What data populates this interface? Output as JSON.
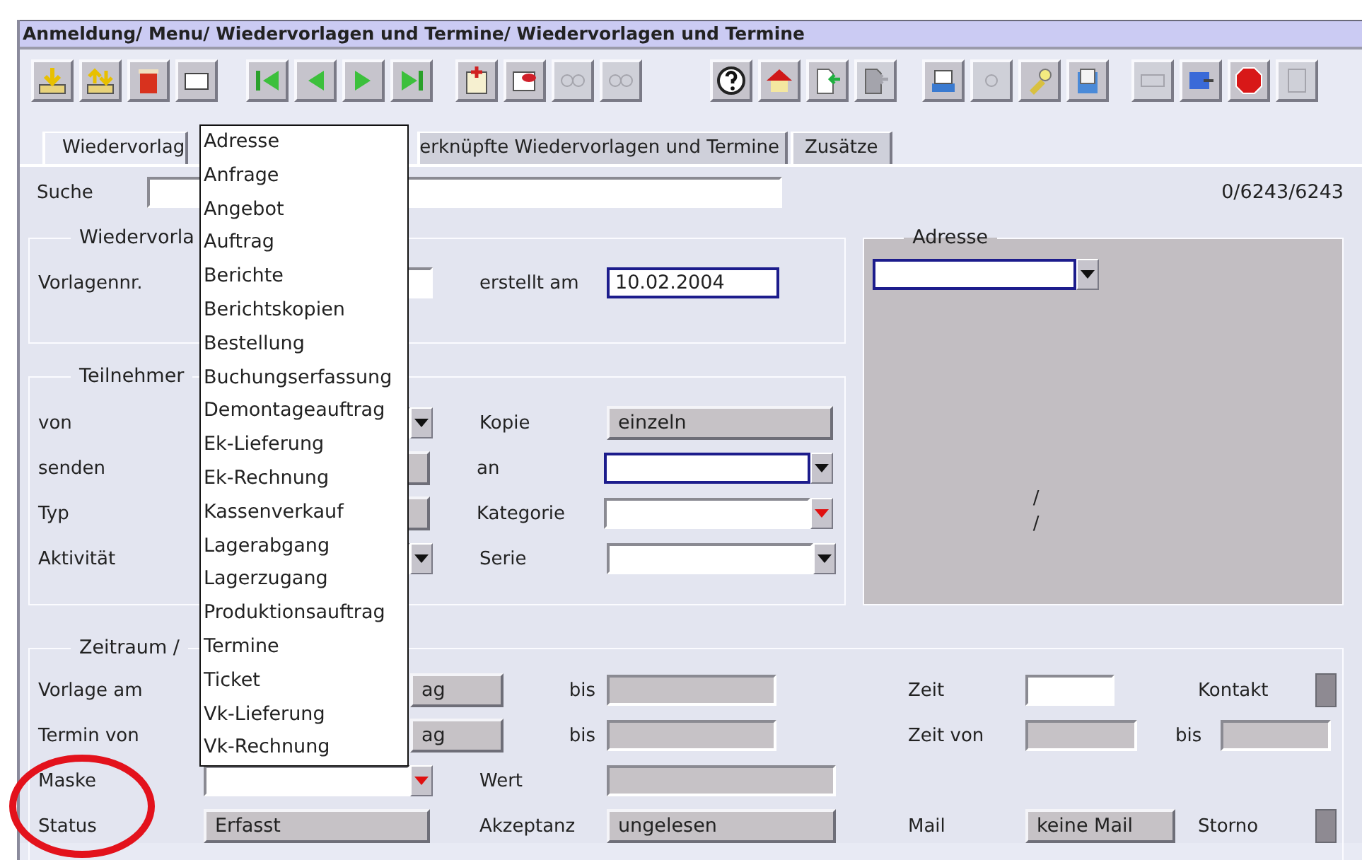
{
  "title_bar": {
    "title": "Anmeldung/ Menu/ Wiedervorlagen und Termine/ Wiedervorlagen und Termine"
  },
  "toolbar": {
    "buttons": [
      {
        "disabled": false
      },
      {
        "disabled": false
      },
      {
        "disabled": false
      },
      {
        "disabled": false
      },
      {
        "disabled": false
      },
      {
        "disabled": false
      },
      {
        "disabled": false
      },
      {
        "disabled": false
      },
      {
        "disabled": false
      },
      {
        "disabled": false
      },
      {
        "disabled": true
      },
      {
        "disabled": true
      },
      {
        "disabled": false
      },
      {
        "disabled": false
      },
      {
        "disabled": false
      },
      {
        "disabled": true
      },
      {
        "disabled": false
      },
      {
        "disabled": true
      },
      {
        "disabled": false
      },
      {
        "disabled": false
      },
      {
        "disabled": true
      },
      {
        "disabled": false
      },
      {
        "disabled": false
      },
      {
        "disabled": true
      }
    ]
  },
  "tabs": [
    {
      "label": "Wiedervorlag",
      "selected": true
    },
    {
      "label": "erknüpfte Wiedervorlagen und Termine",
      "selected": false
    },
    {
      "label": "Zusätze",
      "selected": false
    }
  ],
  "search": {
    "label": "Suche",
    "counter": "0/6243/6243"
  },
  "template_group": {
    "legend": "Wiedervorla",
    "number_label": "Vorlagennr.",
    "created_label": "erstellt am",
    "created_value": "10.02.2004",
    "created_focused": true
  },
  "address_panel": {
    "legend": "Adresse",
    "combo": {
      "focused": true
    },
    "lines": [
      "/",
      "/"
    ]
  },
  "participants_group": {
    "legend": "Teilnehmer",
    "rows": [
      {
        "label": "von",
        "control": {
          "kind": "combo",
          "focused": false,
          "mandatory": false
        },
        "right_label": "Kopie",
        "right": {
          "kind": "button",
          "text": "einzeln"
        }
      },
      {
        "label": "senden",
        "control": {
          "kind": "button"
        },
        "right_label": "an",
        "right": {
          "kind": "combo",
          "focused": true,
          "mandatory": false
        }
      },
      {
        "label": "Typ",
        "control": {
          "kind": "button"
        },
        "right_label": "Kategorie",
        "right": {
          "kind": "combo",
          "focused": false,
          "mandatory": true
        }
      },
      {
        "label": "Aktivität",
        "control": {
          "kind": "combo",
          "focused": false,
          "mandatory": false
        },
        "right_label": "Serie",
        "right": {
          "kind": "combo",
          "focused": false,
          "mandatory": false
        }
      }
    ]
  },
  "period_group": {
    "legend": "Zeitraum /",
    "rows": [
      {
        "label": "Vorlage am",
        "button": "ag",
        "to_label": "bis",
        "to_disabled": true,
        "time_label": "Zeit",
        "time_disabled": false,
        "flag_label": "Kontakt"
      },
      {
        "label": "Termin von",
        "button": "ag",
        "to_label": "bis",
        "to_disabled": true,
        "time_label": "Zeit von",
        "time_disabled": true,
        "time_to_label": "bis",
        "time_to_disabled": true
      }
    ],
    "mask_row": {
      "label": "Maske",
      "mandatory": true,
      "value_label": "Wert",
      "value_disabled": true
    },
    "status_row": {
      "label": "Status",
      "status": "Erfasst",
      "acceptance_label": "Akzeptanz",
      "acceptance": "ungelesen",
      "mail_label": "Mail",
      "mail": "keine Mail",
      "flag_label": "Storno"
    }
  },
  "type_dropdown": {
    "options": [
      "Adresse",
      "Anfrage",
      "Angebot",
      "Auftrag",
      "Berichte",
      "Berichtskopien",
      "Bestellung",
      "Buchungserfassung",
      "Demontageauftrag",
      "Ek-Lieferung",
      "Ek-Rechnung",
      "Kassenverkauf",
      "Lagerabgang",
      "Lagerzugang",
      "Produktionsauftrag",
      "Termine",
      "Ticket",
      "Vk-Lieferung",
      "Vk-Rechnung"
    ]
  },
  "annotation": {
    "kind": "ellipse"
  }
}
